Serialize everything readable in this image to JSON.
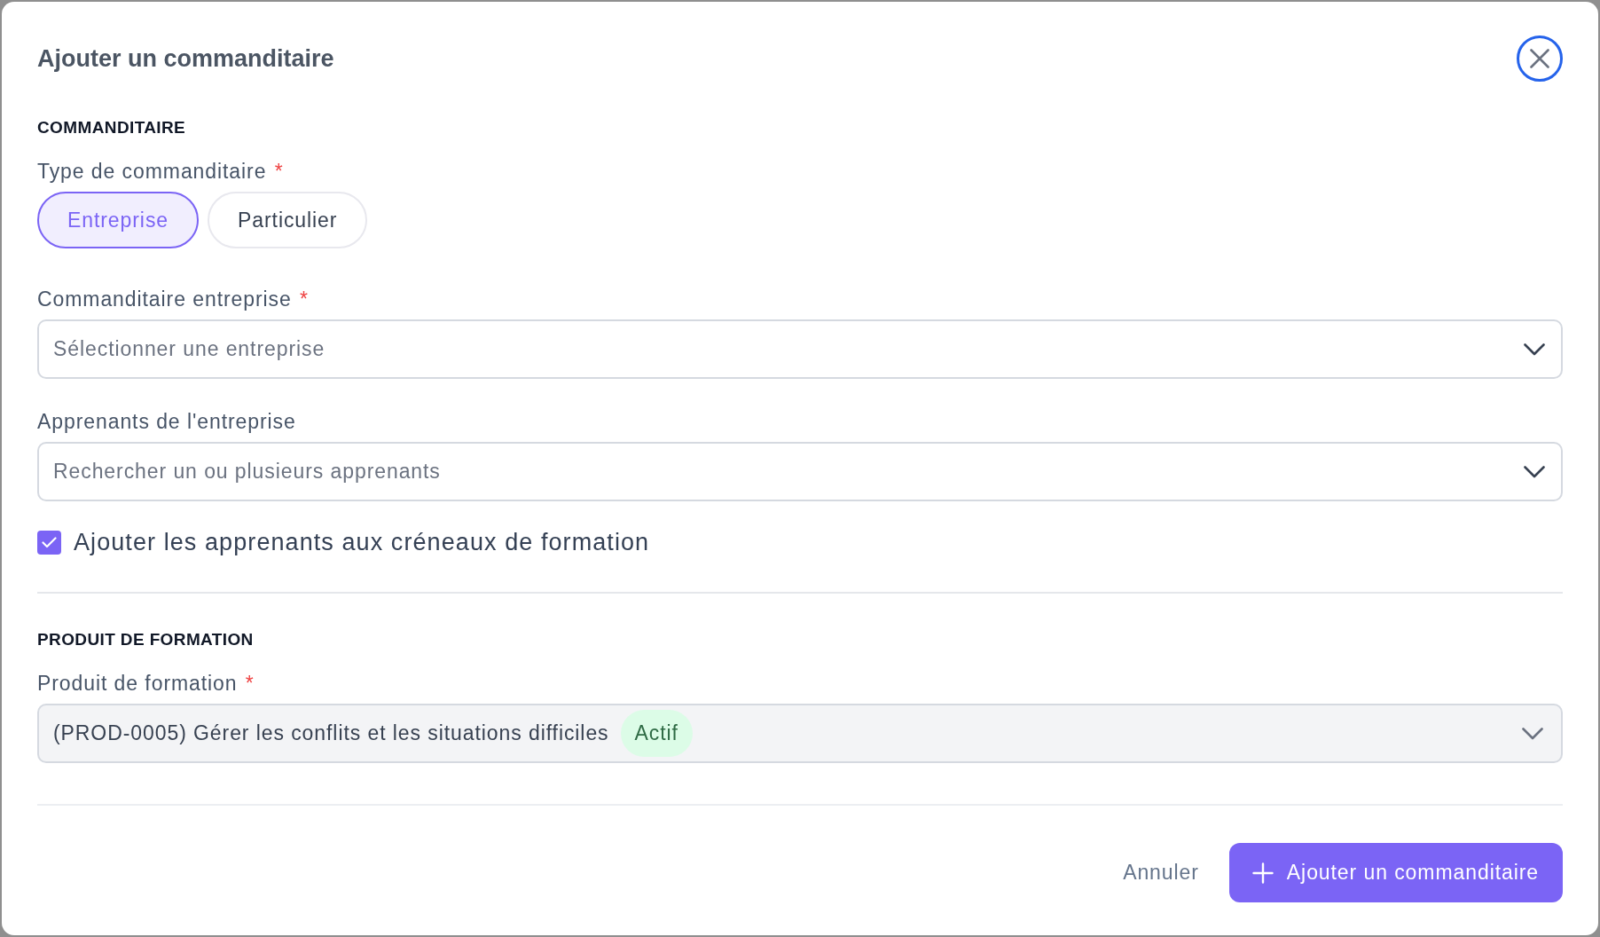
{
  "dialog": {
    "title": "Ajouter un commanditaire"
  },
  "sections": [
    {
      "heading": "COMMANDITAIRE",
      "fields": [
        {
          "kind": "toggle_group",
          "label": "Type de commanditaire",
          "required_mark": "*",
          "options": [
            {
              "label": "Entreprise",
              "selected": true
            },
            {
              "label": "Particulier",
              "selected": false
            }
          ]
        },
        {
          "kind": "select",
          "label": "Commanditaire entreprise",
          "required_mark": "*",
          "placeholder": "Sélectionner une entreprise",
          "disabled": false
        },
        {
          "kind": "select",
          "label": "Apprenants de l'entreprise",
          "placeholder": "Rechercher un ou plusieurs apprenants",
          "disabled": false
        },
        {
          "kind": "checkbox",
          "label": "Ajouter les apprenants aux créneaux de formation",
          "checked": true
        }
      ]
    },
    {
      "heading": "PRODUIT DE FORMATION",
      "fields": [
        {
          "kind": "select",
          "label": "Produit de formation",
          "required_mark": "*",
          "value": "(PROD-0005) Gérer les conflits et les situations difficiles",
          "badge": "Actif",
          "disabled": true
        }
      ]
    }
  ],
  "footer": {
    "buttons": [
      {
        "kind": "secondary",
        "label": "Annuler"
      },
      {
        "kind": "primary",
        "label": "Ajouter un commanditaire"
      }
    ]
  }
}
